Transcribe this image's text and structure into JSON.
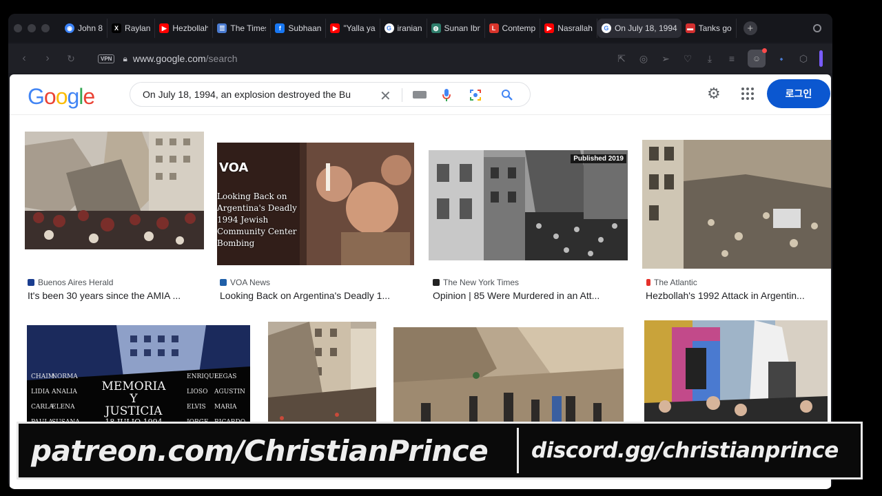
{
  "browser": {
    "tabs": [
      {
        "label": "John 8",
        "favicon": "blue-circle-icon",
        "color": "#3b82f6"
      },
      {
        "label": "Raylan",
        "favicon": "x-icon",
        "color": "#000000"
      },
      {
        "label": "Hezbollah",
        "favicon": "youtube-icon",
        "color": "#ff0000"
      },
      {
        "label": "The Times",
        "favicon": "news-icon",
        "color": "#4a7bd0"
      },
      {
        "label": "Subhaan",
        "favicon": "facebook-icon",
        "color": "#1877f2"
      },
      {
        "label": "\"Yalla ya",
        "favicon": "youtube-icon",
        "color": "#ff0000"
      },
      {
        "label": "iranian",
        "favicon": "google-icon",
        "color": "#4285f4"
      },
      {
        "label": "Sunan Ibn",
        "favicon": "globe-icon",
        "color": "#2e7d6b"
      },
      {
        "label": "Contemp",
        "favicon": "loc-icon",
        "color": "#d9342b"
      },
      {
        "label": "Nasrallah",
        "favicon": "youtube-icon",
        "color": "#ff0000"
      },
      {
        "label": "On July 18, 1994",
        "favicon": "google-icon",
        "color": "#4285f4",
        "active": true
      },
      {
        "label": "Tanks go",
        "favicon": "flag-icon",
        "color": "#d32f2f"
      }
    ],
    "url_host": "www.google.com",
    "url_path": "/search",
    "vpn_label": "VPN"
  },
  "google": {
    "logo_letters": [
      "G",
      "o",
      "o",
      "g",
      "l",
      "e"
    ],
    "logo_colors": [
      "#4285F4",
      "#EA4335",
      "#FBBC05",
      "#4285F4",
      "#34A853",
      "#EA4335"
    ],
    "query": "On July 18, 1994, an explosion destroyed the Bu",
    "login_label": "로그인"
  },
  "results": [
    {
      "source": "Buenos Aires Herald",
      "caption": "It's been 30 years since the AMIA ...",
      "src_color": "#1a3d8f"
    },
    {
      "source": "VOA News",
      "caption": "Looking Back on Argentina's Deadly 1...",
      "src_color": "#1f5fa8",
      "overlay_brand": "VOA",
      "overlay_lines": [
        "Looking Back on",
        "Argentina's Deadly",
        "1994 Jewish",
        "Community Center",
        "Bombing"
      ]
    },
    {
      "source": "The New York Times",
      "caption": "Opinion | 85 Were Murdered in an Att...",
      "src_color": "#222222",
      "badge": "Published 2019"
    },
    {
      "source": "The Atlantic",
      "caption": "Hezbollah's 1992 Attack in Argentin...",
      "src_color": "#e5312b"
    },
    {
      "sign_lines": [
        "MEMORIA",
        "Y",
        "JUSTICIA",
        "18 JULIO 1994"
      ],
      "names": [
        "CHAIM",
        "NORMA",
        "LIDIA",
        "ANALIA",
        "CARLA",
        "ELENA",
        "PAULA",
        "SUSANA",
        "ENRIQUE",
        "LEGAS",
        "LIOSO",
        "AGUSTIN",
        "ELVIS",
        "MARIA",
        "JORGE",
        "RICARDO"
      ]
    },
    {},
    {},
    {}
  ],
  "banner": {
    "left": "patreon.com/ChristianPrince",
    "right": "discord.gg/christianprince"
  }
}
